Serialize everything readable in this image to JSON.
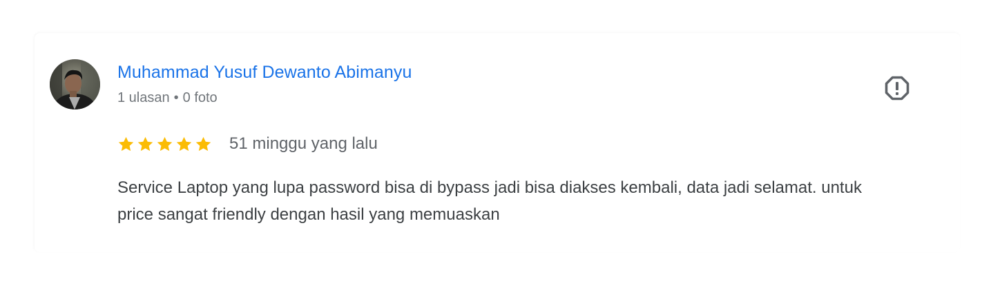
{
  "review": {
    "author": {
      "name": "Muhammad Yusuf Dewanto Abimanyu",
      "reviews_count": "1 ulasan",
      "separator": "•",
      "photos_count": "0 foto"
    },
    "rating": 5,
    "max_rating": 5,
    "time": "51 minggu yang lalu",
    "text": "Service Laptop yang lupa password bisa di bypass jadi bisa diakses kembali, data jadi selamat. untuk price sangat friendly dengan hasil yang memuaskan"
  },
  "icons": {
    "flag": "report-flag-icon",
    "star": "star-icon"
  },
  "colors": {
    "author_link": "#1a73e8",
    "star": "#fbbc04",
    "meta_text": "#70757a",
    "body_text": "#3c4043",
    "flag_icon": "#5f6368"
  }
}
